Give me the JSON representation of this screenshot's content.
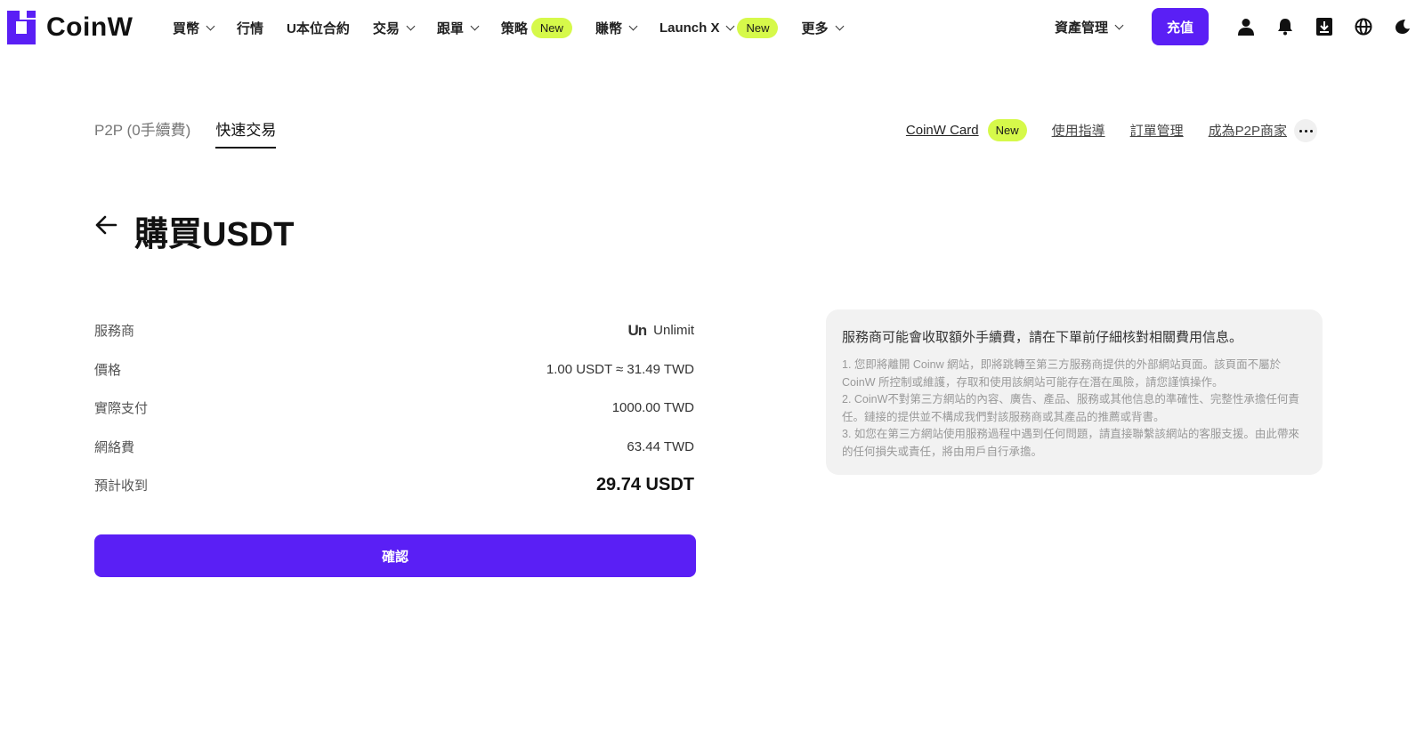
{
  "brand": {
    "name": "CoinW",
    "accent_color": "#5a1ff5",
    "badge_color": "#d6f94a"
  },
  "nav": {
    "items": [
      {
        "label": "買幣",
        "dropdown": true,
        "badge": ""
      },
      {
        "label": "行情",
        "dropdown": false,
        "badge": ""
      },
      {
        "label": "U本位合約",
        "dropdown": false,
        "badge": ""
      },
      {
        "label": "交易",
        "dropdown": true,
        "badge": ""
      },
      {
        "label": "跟單",
        "dropdown": true,
        "badge": ""
      },
      {
        "label": "策略",
        "dropdown": false,
        "badge": "New"
      },
      {
        "label": "賺幣",
        "dropdown": true,
        "badge": ""
      },
      {
        "label": "Launch X",
        "dropdown": true,
        "badge": "New"
      },
      {
        "label": "更多",
        "dropdown": true,
        "badge": ""
      }
    ]
  },
  "header": {
    "assets_label": "資產管理",
    "deposit_label": "充值",
    "icons": [
      "user-icon",
      "bell-icon",
      "download-icon",
      "globe-icon",
      "moon-icon"
    ]
  },
  "subnav": {
    "tabs": [
      {
        "label": "P2P (0手續費)",
        "active": false
      },
      {
        "label": "快速交易",
        "active": true
      }
    ],
    "links": {
      "card": "CoinW Card",
      "card_badge": "New",
      "guide": "使用指導",
      "orders": "訂單管理",
      "merchant": "成為P2P商家"
    }
  },
  "page": {
    "title": "購買USDT"
  },
  "details": {
    "provider_label": "服務商",
    "provider_logo": "Un",
    "provider_name": "Unlimit",
    "price_label": "價格",
    "price_value": "1.00 USDT ≈ 31.49 TWD",
    "pay_label": "實際支付",
    "pay_value": "1000.00 TWD",
    "fee_label": "網絡費",
    "fee_value": "63.44 TWD",
    "receive_label": "預計收到",
    "receive_value": "29.74 USDT"
  },
  "confirm": {
    "label": "確認"
  },
  "notice": {
    "title": "服務商可能會收取額外手續費，請在下單前仔細核對相關費用信息。",
    "lines": [
      "1. 您即將離開 Coinw 網站，即將跳轉至第三方服務商提供的外部網站頁面。該頁面不屬於CoinW 所控制或維護，存取和使用該網站可能存在潛在風險，請您謹慎操作。",
      "2. CoinW不對第三方網站的內容、廣告、產品、服務或其他信息的準確性、完整性承擔任何責任。鏈接的提供並不構成我們對該服務商或其產品的推薦或背書。",
      "3. 如您在第三方網站使用服務過程中遇到任何問題，請直接聯繫該網站的客服支援。由此帶來的任何損失或責任，將由用戶自行承擔。"
    ]
  }
}
